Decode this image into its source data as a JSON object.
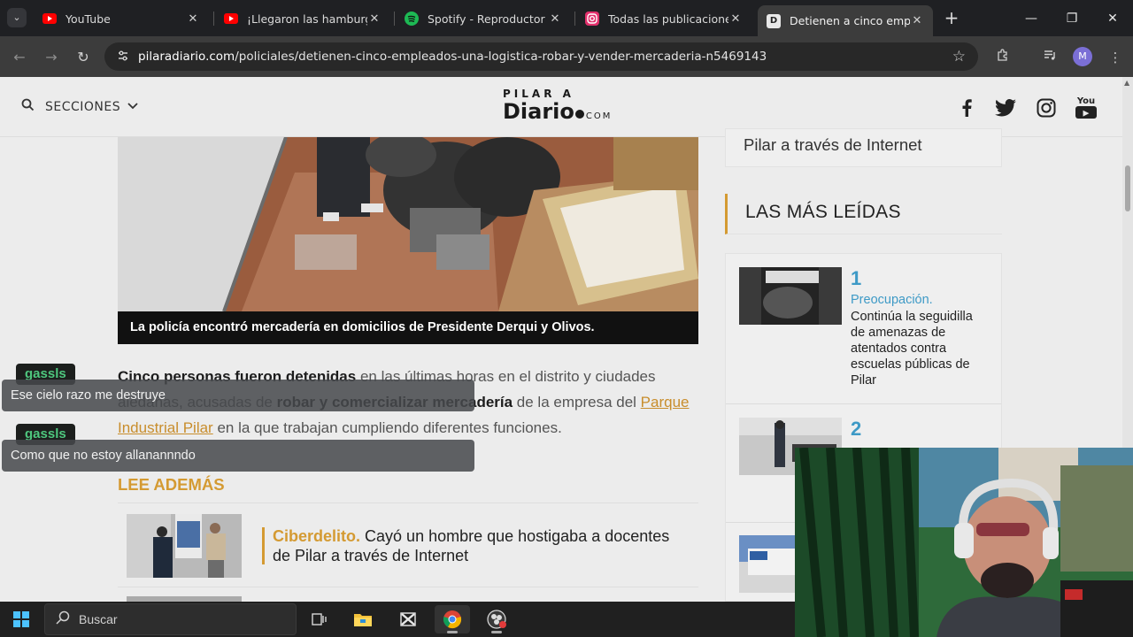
{
  "browser": {
    "tabs": [
      {
        "title": "YouTube",
        "icon": "youtube-icon",
        "color": "#ff0000"
      },
      {
        "title": "¡Llegaron las hamburgue",
        "icon": "youtube-icon",
        "color": "#ff0000"
      },
      {
        "title": "Spotify - Reproductor we",
        "icon": "spotify-icon",
        "color": "#1db954"
      },
      {
        "title": "Todas las publicaciones -",
        "icon": "instagram-icon",
        "color": "#e1306c"
      },
      {
        "title": "Detienen a cinco emplea",
        "icon": "diario-icon",
        "color": "#ffffff"
      }
    ],
    "url_host": "pilaradiario.com",
    "url_path": "/policiales/detienen-cinco-empleados-una-logistica-robar-y-vender-mercaderia-n5469143",
    "profile_initial": "M"
  },
  "site": {
    "sections_label": "SECCIONES",
    "logo_top": "PILAR A",
    "logo_main": "Diario",
    "logo_com": "COM",
    "social": [
      "facebook-icon",
      "twitter-icon",
      "instagram-icon",
      "youtube-icon"
    ],
    "youtube_text": "You"
  },
  "article": {
    "caption": "La policía encontró mercadería en domicilios de Presidente Derqui y Olivos.",
    "p1_b1": "Cinco personas fueron detenidas",
    "p1_t1": " en las últimas horas en el distrito y ciudades aledañas, acusadas de ",
    "p1_b2": "robar y comercializar mercadería",
    "p1_t2": " de la empresa del ",
    "p1_link": "Parque Industrial Pilar",
    "p1_t3": " en la que trabajan cumpliendo diferentes funciones.",
    "lee_ademas": "LEE ADEMÁS",
    "related_kicker": "Ciberdelito.",
    "related_title": "Cayó un hombre que hostigaba a docentes de Pilar a través de Internet"
  },
  "sidebar": {
    "top_card_text": "Pilar a través de Internet",
    "mas_leidas": "LAS MÁS LEÍDAS",
    "items": [
      {
        "num": "1",
        "kicker": "Preocupación.",
        "text": "Continúa la seguidilla de amenazas de atentados contra escuelas públicas de Pilar"
      },
      {
        "num": "2",
        "kicker": "",
        "text": ""
      }
    ]
  },
  "chat": [
    {
      "user": "gassls",
      "message": "Ese cielo razo me destruye"
    },
    {
      "user": "gassls",
      "message": "Como que no estoy allanannndo"
    }
  ],
  "taskbar": {
    "search_label": "Buscar"
  }
}
